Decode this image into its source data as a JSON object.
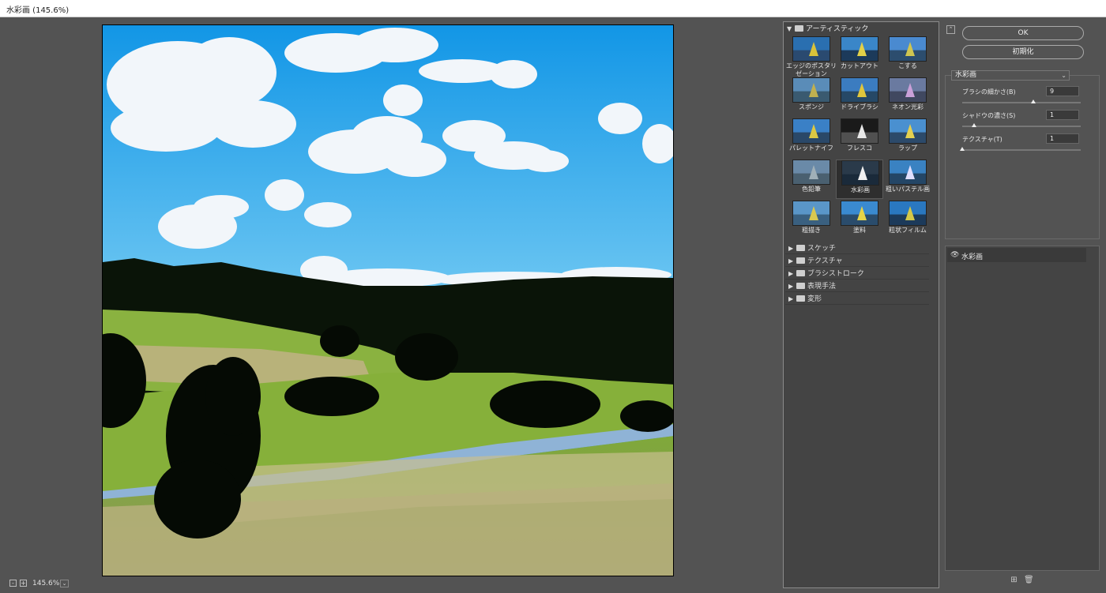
{
  "window": {
    "title": "水彩画 (145.6%)"
  },
  "zoom": {
    "value": "145.6%",
    "minus": "-",
    "plus": "+",
    "dropdown": "⌄"
  },
  "gallery": {
    "category": "アーティスティック",
    "filters": [
      "エッジのポスタリゼーション",
      "カットアウト",
      "こする",
      "スポンジ",
      "ドライブラシ",
      "ネオン光彩",
      "パレットナイフ",
      "フレスコ",
      "ラップ",
      "色鉛筆",
      "水彩画",
      "粗いパステル画",
      "粗描き",
      "塗料",
      "粒状フィルム"
    ],
    "selected": "水彩画",
    "subcategories": [
      "スケッチ",
      "テクスチャ",
      "ブラシストローク",
      "表現手法",
      "変形"
    ]
  },
  "actions": {
    "ok": "OK",
    "reset": "初期化",
    "collapse": "⌃"
  },
  "settings": {
    "filter": "水彩画",
    "params": [
      {
        "label": "ブラシの細かさ(B)",
        "value": "9",
        "fraction": 0.6
      },
      {
        "label": "シャドウの濃さ(S)",
        "value": "1",
        "fraction": 0.1
      },
      {
        "label": "テクスチャ(T)",
        "value": "1",
        "fraction": 0.0
      }
    ]
  },
  "layers": {
    "items": [
      "水彩画"
    ],
    "new_icon": "⊞",
    "delete_icon": "🗑"
  }
}
